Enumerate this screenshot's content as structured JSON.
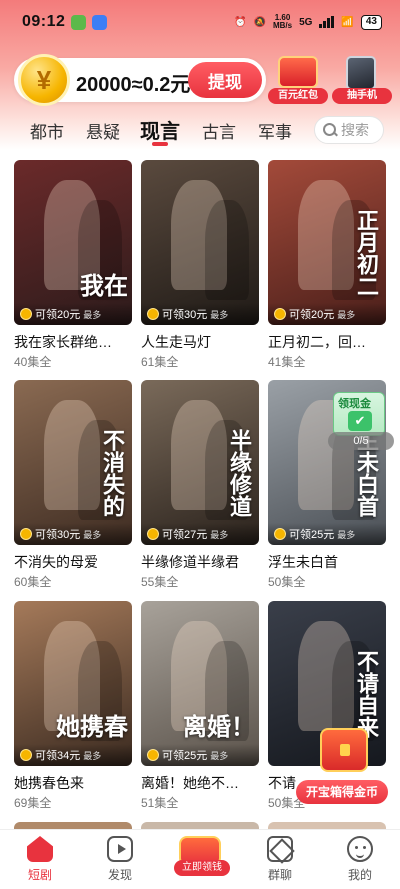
{
  "status_bar": {
    "time": "09:12",
    "net_speed_value": "1.60",
    "net_speed_unit": "MB/s",
    "network": "5G",
    "battery": "43"
  },
  "header": {
    "coin_text": "20000≈0.2元",
    "coin_symbol": "¥",
    "withdraw_label": "提现",
    "promo_redpack_label": "百元红包",
    "promo_phone_label": "抽手机"
  },
  "tabs": [
    {
      "label": "都市"
    },
    {
      "label": "悬疑"
    },
    {
      "label": "现言"
    },
    {
      "label": "古言"
    },
    {
      "label": "军事"
    }
  ],
  "active_tab": 2,
  "search": {
    "placeholder": "搜索"
  },
  "dramas": [
    {
      "title": "我在家长群绝…",
      "episodes": "40集全",
      "reward": "可领20元",
      "reward_max": "最多",
      "poster_text": "我在",
      "colors": [
        "#6b2a2a",
        "#2c1b1b"
      ]
    },
    {
      "title": "人生走马灯",
      "episodes": "61集全",
      "reward": "可领30元",
      "reward_max": "最多",
      "poster_text": "",
      "colors": [
        "#5a4a3e",
        "#1f1a16"
      ]
    },
    {
      "title": "正月初二，回…",
      "episodes": "41集全",
      "reward": "可领20元",
      "reward_max": "最多",
      "poster_text": "正月初二",
      "colors": [
        "#a34a3a",
        "#4a1f1a"
      ]
    },
    {
      "title": "不消失的母爱",
      "episodes": "60集全",
      "reward": "可领30元",
      "reward_max": "最多",
      "poster_text": "不消失的",
      "colors": [
        "#8a6a52",
        "#3e2c22"
      ]
    },
    {
      "title": "半缘修道半缘君",
      "episodes": "55集全",
      "reward": "可领27元",
      "reward_max": "最多",
      "poster_text": "半缘修道",
      "colors": [
        "#7a6a5a",
        "#2a221c"
      ]
    },
    {
      "title": "浮生未白首",
      "episodes": "50集全",
      "reward": "可领25元",
      "reward_max": "最多",
      "poster_text": "浮生未白首",
      "colors": [
        "#9aa0a6",
        "#4a4f55"
      ]
    },
    {
      "title": "她携春色来",
      "episodes": "69集全",
      "reward": "可领34元",
      "reward_max": "最多",
      "poster_text": "她携春",
      "colors": [
        "#a57a5a",
        "#3a2a20"
      ]
    },
    {
      "title": "离婚！她绝不…",
      "episodes": "51集全",
      "reward": "可领25元",
      "reward_max": "最多",
      "poster_text": "离婚！",
      "colors": [
        "#a8a29a",
        "#5a524a"
      ]
    },
    {
      "title": "不请…",
      "episodes": "50集全",
      "reward": "",
      "reward_max": "",
      "poster_text": "不请自来",
      "colors": [
        "#3a3f4a",
        "#15181e"
      ]
    }
  ],
  "widgets": {
    "claim_label": "领现金",
    "progress": "0/5",
    "treasure_label": "开宝箱得金币"
  },
  "bottom_nav": [
    {
      "label": "短剧",
      "icon": "home-icon"
    },
    {
      "label": "发现",
      "icon": "play-icon"
    },
    {
      "label": "立即领钱",
      "icon": "redpack-icon"
    },
    {
      "label": "群聊",
      "icon": "group-icon"
    },
    {
      "label": "我的",
      "icon": "profile-icon"
    }
  ],
  "accent_color": "#e8333e"
}
